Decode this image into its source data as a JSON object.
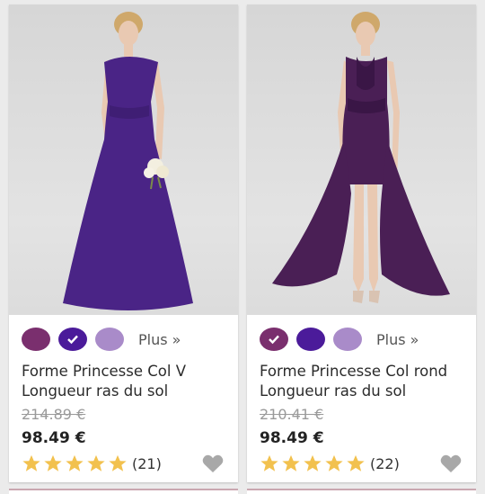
{
  "products": [
    {
      "swatches": [
        {
          "color": "#7a2f6e",
          "selected": false
        },
        {
          "color": "#4b1b9a",
          "selected": true
        },
        {
          "color": "#a98bc9",
          "selected": false
        }
      ],
      "more_label": "Plus »",
      "title_line1": "Forme Princesse Col V",
      "title_line2": "Longueur ras du sol",
      "old_price": "214.89 €",
      "price": "98.49 €",
      "rating_stars": 5,
      "review_count": "(21)",
      "dress_color": "#4a2486"
    },
    {
      "swatches": [
        {
          "color": "#7a2f6e",
          "selected": true
        },
        {
          "color": "#4b1b9a",
          "selected": false
        },
        {
          "color": "#a98bc9",
          "selected": false
        }
      ],
      "more_label": "Plus »",
      "title_line1": "Forme Princesse Col rond",
      "title_line2": "Longueur ras du sol",
      "old_price": "210.41 €",
      "price": "98.49 €",
      "rating_stars": 5,
      "review_count": "(22)",
      "dress_color": "#4a1f55"
    }
  ],
  "colors": {
    "star": "#f2c14e",
    "heart": "#a8a8a8",
    "skin": "#e9c9b2",
    "hair": "#cfa86b"
  }
}
